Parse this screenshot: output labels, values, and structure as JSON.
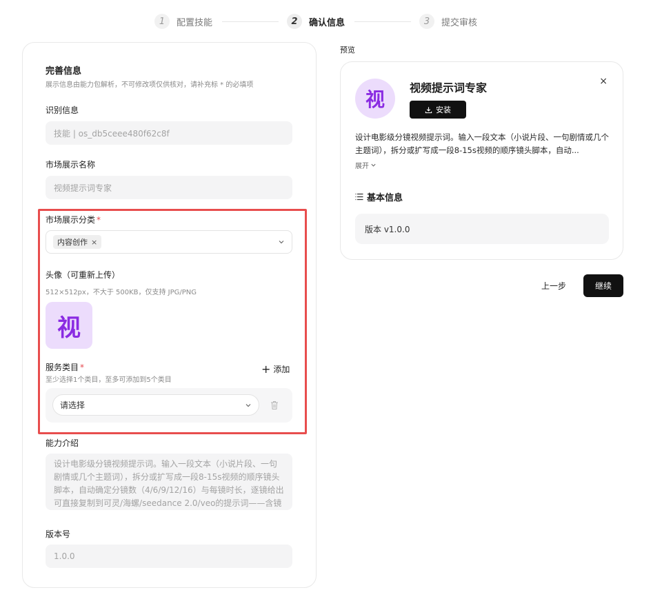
{
  "steps": [
    {
      "num": "1",
      "label": "配置技能"
    },
    {
      "num": "2",
      "label": "确认信息"
    },
    {
      "num": "3",
      "label": "提交审核"
    }
  ],
  "form": {
    "title": "完善信息",
    "subtitle": "展示信息由能力包解析，不可修改项仅供核对，请补充标 * 的必填项",
    "id_label": "识别信息",
    "id_value": "技能 | os_db5ceee480f62c8f",
    "market_name_label": "市场展示名称",
    "market_name_value": "视频提示词专家",
    "category_label": "市场展示分类",
    "category_chip": "内容创作",
    "chip_remove": "×",
    "avatar_label": "头像（可重新上传）",
    "avatar_hint": "512×512px，不大于 500KB，仅支持 JPG/PNG",
    "avatar_glyph": "视",
    "service_label": "服务类目",
    "service_hint": "至少选择1个类目，至多可添加到5个类目",
    "add_label": "添加",
    "service_placeholder": "请选择",
    "intro_label": "能力介绍",
    "intro_value": "设计电影级分镜视频提示词。输入一段文本（小说片段、一句剧情或几个主题词），拆分或扩写成一段8-15s视频的顺序镜头脚本，自动确定分镜数（4/6/9/12/16）与每镜时长，逐镜给出可直接复制到可灵/海螺/seedance 2.0/veo的提示词——含镜号、场景、景别、机位、动作以及光线、色彩基调、音效/对白",
    "version_label": "版本号",
    "version_value": "1.0.0",
    "required_mark": "*"
  },
  "preview": {
    "label": "预览",
    "avatar_glyph": "视",
    "title": "视频提示词专家",
    "install_label": "安装",
    "close": "×",
    "description": "设计电影级分镜视频提示词。输入一段文本（小说片段、一句剧情或几个主题词），拆分或扩写成一段8-15s视频的顺序镜头脚本，自动...",
    "expand_label": "展开",
    "basic_info_title": "基本信息",
    "version_text": "版本  v1.0.0"
  },
  "actions": {
    "back_label": "上一步",
    "next_label": "继续"
  }
}
